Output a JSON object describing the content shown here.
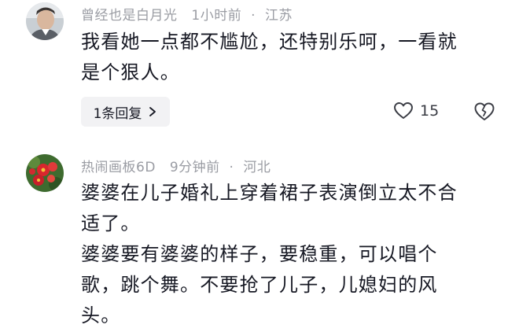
{
  "comments": [
    {
      "username": "曾经也是白月光",
      "time": "1小时前",
      "separator": "·",
      "location": "江苏",
      "lines": [
        "我看她一点都不尴尬，还特别乐呵，一看就",
        "是个狠人。"
      ],
      "reply_label": "1条回复",
      "likes": "15",
      "avatar": "avatar-man-icon"
    },
    {
      "username": "热闹画板6D",
      "time": "9分钟前",
      "separator": "·",
      "location": "河北",
      "lines": [
        "婆婆在儿子婚礼上穿着裙子表演倒立太不合",
        "适了。",
        "婆婆要有婆婆的样子，要稳重，可以唱个",
        "歌，跳个舞。不要抢了儿子，儿媳妇的风",
        "头。"
      ],
      "avatar": "avatar-flower-icon"
    }
  ],
  "colors": {
    "meta": "#9a9ca3",
    "text": "#161823",
    "pill_bg": "#f2f2f4"
  }
}
